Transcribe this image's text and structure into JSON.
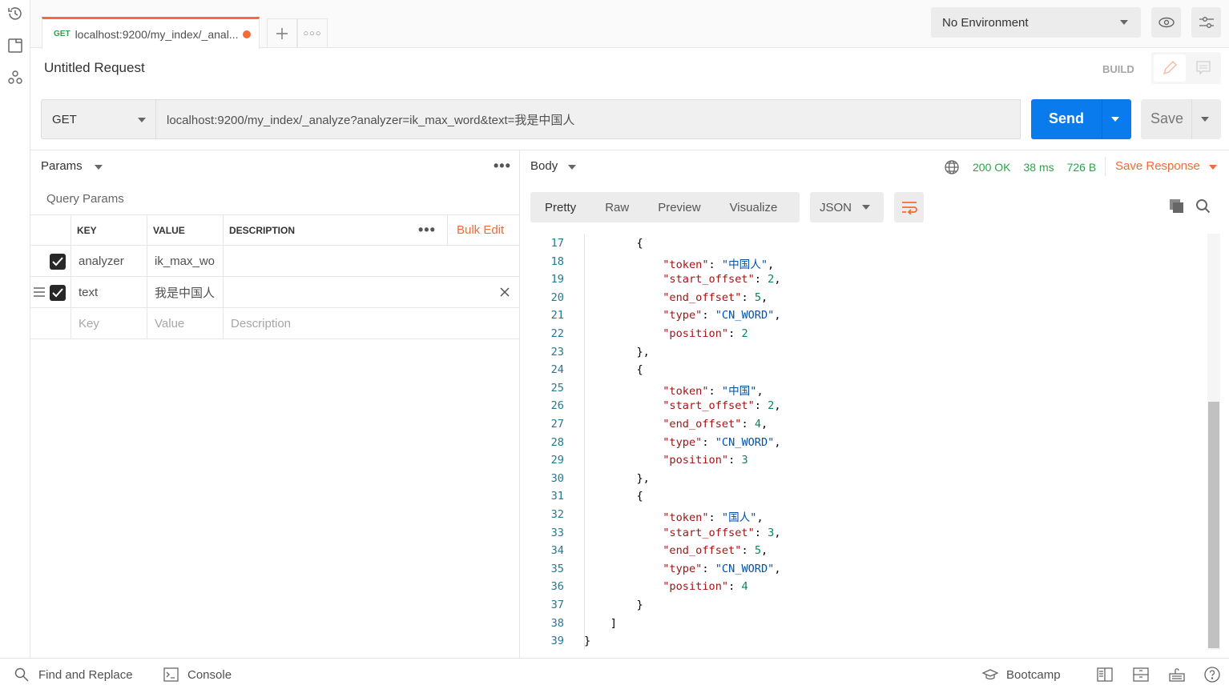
{
  "sidebar": {
    "icons": [
      "history-icon",
      "collections-icon",
      "apis-icon"
    ]
  },
  "tabs": {
    "active": {
      "method": "GET",
      "label": "localhost:9200/my_index/_anal...",
      "unsaved": true
    }
  },
  "environment": {
    "selected": "No Environment"
  },
  "request": {
    "title": "Untitled Request",
    "mode": "BUILD",
    "method": "GET",
    "url": "localhost:9200/my_index/_analyze?analyzer=ik_max_word&text=我是中国人",
    "send_label": "Send",
    "save_label": "Save"
  },
  "params": {
    "tab_label": "Params",
    "section_title": "Query Params",
    "bulk_edit": "Bulk Edit",
    "headers": [
      "KEY",
      "VALUE",
      "DESCRIPTION"
    ],
    "rows": [
      {
        "key": "analyzer",
        "value": "ik_max_wo",
        "description": "",
        "checked": true
      },
      {
        "key": "text",
        "value": "我是中国人",
        "description": "",
        "checked": true
      }
    ],
    "placeholders": {
      "key": "Key",
      "value": "Value",
      "description": "Description"
    }
  },
  "response": {
    "tab_label": "Body",
    "status": "200 OK",
    "time": "38 ms",
    "size": "726 B",
    "save_response": "Save Response",
    "view_tabs": [
      "Pretty",
      "Raw",
      "Preview",
      "Visualize"
    ],
    "active_view": "Pretty",
    "format": "JSON",
    "colors": {
      "key": "#a31515",
      "string": "#0451a5",
      "number": "#098658",
      "line_number": "#237893"
    },
    "code_lines": [
      {
        "n": "17",
        "t": [
          [
            "p",
            "        {"
          ]
        ]
      },
      {
        "n": "18",
        "t": [
          [
            "p",
            "            "
          ],
          [
            "k",
            "\"token\""
          ],
          [
            "p",
            ": "
          ],
          [
            "s",
            "\"中国人\""
          ],
          [
            "p",
            ","
          ]
        ]
      },
      {
        "n": "19",
        "t": [
          [
            "p",
            "            "
          ],
          [
            "k",
            "\"start_offset\""
          ],
          [
            "p",
            ": "
          ],
          [
            "n",
            "2"
          ],
          [
            "p",
            ","
          ]
        ]
      },
      {
        "n": "20",
        "t": [
          [
            "p",
            "            "
          ],
          [
            "k",
            "\"end_offset\""
          ],
          [
            "p",
            ": "
          ],
          [
            "n",
            "5"
          ],
          [
            "p",
            ","
          ]
        ]
      },
      {
        "n": "21",
        "t": [
          [
            "p",
            "            "
          ],
          [
            "k",
            "\"type\""
          ],
          [
            "p",
            ": "
          ],
          [
            "s",
            "\"CN_WORD\""
          ],
          [
            "p",
            ","
          ]
        ]
      },
      {
        "n": "22",
        "t": [
          [
            "p",
            "            "
          ],
          [
            "k",
            "\"position\""
          ],
          [
            "p",
            ": "
          ],
          [
            "n",
            "2"
          ]
        ]
      },
      {
        "n": "23",
        "t": [
          [
            "p",
            "        },"
          ]
        ]
      },
      {
        "n": "24",
        "t": [
          [
            "p",
            "        {"
          ]
        ]
      },
      {
        "n": "25",
        "t": [
          [
            "p",
            "            "
          ],
          [
            "k",
            "\"token\""
          ],
          [
            "p",
            ": "
          ],
          [
            "s",
            "\"中国\""
          ],
          [
            "p",
            ","
          ]
        ]
      },
      {
        "n": "26",
        "t": [
          [
            "p",
            "            "
          ],
          [
            "k",
            "\"start_offset\""
          ],
          [
            "p",
            ": "
          ],
          [
            "n",
            "2"
          ],
          [
            "p",
            ","
          ]
        ]
      },
      {
        "n": "27",
        "t": [
          [
            "p",
            "            "
          ],
          [
            "k",
            "\"end_offset\""
          ],
          [
            "p",
            ": "
          ],
          [
            "n",
            "4"
          ],
          [
            "p",
            ","
          ]
        ]
      },
      {
        "n": "28",
        "t": [
          [
            "p",
            "            "
          ],
          [
            "k",
            "\"type\""
          ],
          [
            "p",
            ": "
          ],
          [
            "s",
            "\"CN_WORD\""
          ],
          [
            "p",
            ","
          ]
        ]
      },
      {
        "n": "29",
        "t": [
          [
            "p",
            "            "
          ],
          [
            "k",
            "\"position\""
          ],
          [
            "p",
            ": "
          ],
          [
            "n",
            "3"
          ]
        ]
      },
      {
        "n": "30",
        "t": [
          [
            "p",
            "        },"
          ]
        ]
      },
      {
        "n": "31",
        "t": [
          [
            "p",
            "        {"
          ]
        ]
      },
      {
        "n": "32",
        "t": [
          [
            "p",
            "            "
          ],
          [
            "k",
            "\"token\""
          ],
          [
            "p",
            ": "
          ],
          [
            "s",
            "\"国人\""
          ],
          [
            "p",
            ","
          ]
        ]
      },
      {
        "n": "33",
        "t": [
          [
            "p",
            "            "
          ],
          [
            "k",
            "\"start_offset\""
          ],
          [
            "p",
            ": "
          ],
          [
            "n",
            "3"
          ],
          [
            "p",
            ","
          ]
        ]
      },
      {
        "n": "34",
        "t": [
          [
            "p",
            "            "
          ],
          [
            "k",
            "\"end_offset\""
          ],
          [
            "p",
            ": "
          ],
          [
            "n",
            "5"
          ],
          [
            "p",
            ","
          ]
        ]
      },
      {
        "n": "35",
        "t": [
          [
            "p",
            "            "
          ],
          [
            "k",
            "\"type\""
          ],
          [
            "p",
            ": "
          ],
          [
            "s",
            "\"CN_WORD\""
          ],
          [
            "p",
            ","
          ]
        ]
      },
      {
        "n": "36",
        "t": [
          [
            "p",
            "            "
          ],
          [
            "k",
            "\"position\""
          ],
          [
            "p",
            ": "
          ],
          [
            "n",
            "4"
          ]
        ]
      },
      {
        "n": "37",
        "t": [
          [
            "p",
            "        }"
          ]
        ]
      },
      {
        "n": "38",
        "t": [
          [
            "p",
            "    ]"
          ]
        ]
      },
      {
        "n": "39",
        "t": [
          [
            "p",
            "}"
          ]
        ]
      }
    ]
  },
  "footer": {
    "find_replace": "Find and Replace",
    "console": "Console",
    "bootcamp": "Bootcamp"
  }
}
